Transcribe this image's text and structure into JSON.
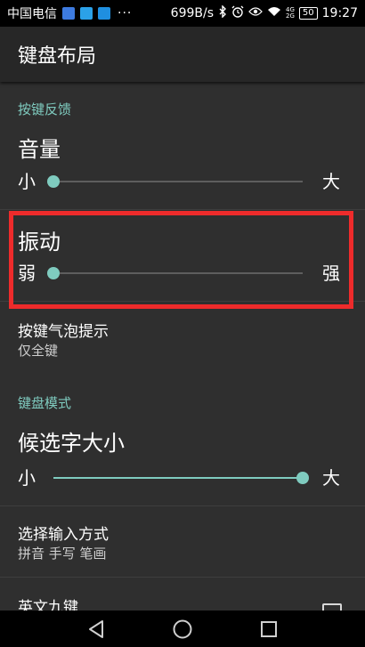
{
  "status_bar": {
    "carrier": "中国电信",
    "app_icons": [
      "notification-icon-1",
      "notification-icon-2",
      "notification-icon-3"
    ],
    "more": "···",
    "net_speed": "699B/s",
    "icons": [
      "bluetooth-icon",
      "alarm-icon",
      "eye-icon",
      "wifi-icon"
    ],
    "network_type_top": "4G",
    "network_type_bottom": "2G",
    "battery": "50",
    "time": "19:27"
  },
  "app_bar": {
    "title": "键盘布局"
  },
  "sections": {
    "feedback": {
      "header": "按键反馈",
      "volume": {
        "title": "音量",
        "min_label": "小",
        "max_label": "大",
        "value": 0.0
      },
      "vibration": {
        "title": "振动",
        "min_label": "弱",
        "max_label": "强",
        "value": 0.0
      },
      "bubble": {
        "title": "按键气泡提示",
        "summary": "仅全键"
      }
    },
    "keyboard_mode": {
      "header": "键盘模式",
      "candidate_size": {
        "title": "候选字大小",
        "min_label": "小",
        "max_label": "大",
        "value": 1.0
      },
      "input_method": {
        "title": "选择输入方式",
        "summary": "拼音 手写 笔画"
      },
      "english_nine": {
        "title": "英文九键",
        "checked": false
      }
    }
  },
  "highlight_color": "#ee2b2b",
  "accent_color": "#7fcbbf",
  "nav_bar": {
    "icons": [
      "back-icon",
      "home-icon",
      "recents-icon"
    ]
  }
}
